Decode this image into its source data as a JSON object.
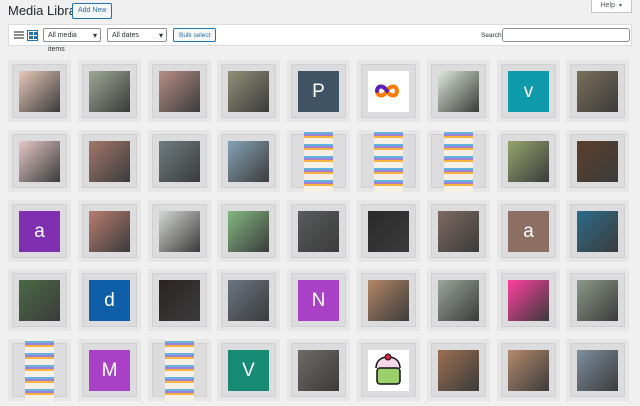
{
  "header": {
    "title": "Media Library",
    "add_new": "Add New",
    "help": "Help"
  },
  "toolbar": {
    "media_filter": "All media items",
    "date_filter": "All dates",
    "bulk_select": "Bulk select",
    "search_label": "Search",
    "search_value": ""
  },
  "media": [
    {
      "kind": "photo",
      "color": "#e8c8b8"
    },
    {
      "kind": "photo",
      "color": "#9ea895"
    },
    {
      "kind": "photo",
      "color": "#b78e85"
    },
    {
      "kind": "photo",
      "color": "#8f9076"
    },
    {
      "kind": "letter",
      "letter": "P",
      "color": "#3f5364"
    },
    {
      "kind": "icon",
      "icon": "infinity-icon",
      "color": "#ffffff"
    },
    {
      "kind": "photo",
      "color": "#dce8d8"
    },
    {
      "kind": "letter",
      "letter": "v",
      "color": "#0f9aac"
    },
    {
      "kind": "photo",
      "color": "#7a6f59"
    },
    {
      "kind": "photo",
      "color": "#e5c8c6"
    },
    {
      "kind": "photo",
      "color": "#a3776b"
    },
    {
      "kind": "photo",
      "color": "#6f7d7f"
    },
    {
      "kind": "photo",
      "color": "#86a3b6"
    },
    {
      "kind": "stickers",
      "color": "#f3f0ea"
    },
    {
      "kind": "stickers",
      "color": "#f3f0ea"
    },
    {
      "kind": "stickers",
      "color": "#f3f0ea"
    },
    {
      "kind": "photo",
      "color": "#95a46c"
    },
    {
      "kind": "photo",
      "color": "#5c3f2c"
    },
    {
      "kind": "letter",
      "letter": "a",
      "color": "#7f2fb0"
    },
    {
      "kind": "photo",
      "color": "#b87d70"
    },
    {
      "kind": "photo",
      "color": "#d5d7d3"
    },
    {
      "kind": "photo",
      "color": "#83b880"
    },
    {
      "kind": "photo",
      "color": "#5a5b5c"
    },
    {
      "kind": "photo",
      "color": "#2a2a2a"
    },
    {
      "kind": "photo",
      "color": "#7e6a61"
    },
    {
      "kind": "letter",
      "letter": "a",
      "color": "#8d6e63"
    },
    {
      "kind": "photo",
      "color": "#2c6c8a"
    },
    {
      "kind": "photo",
      "color": "#4b6a45"
    },
    {
      "kind": "letter",
      "letter": "d",
      "color": "#0f5fa8"
    },
    {
      "kind": "photo",
      "color": "#2a2424"
    },
    {
      "kind": "photo",
      "color": "#6a7480"
    },
    {
      "kind": "letter",
      "letter": "N",
      "color": "#a941c7"
    },
    {
      "kind": "photo",
      "color": "#b38666"
    },
    {
      "kind": "photo",
      "color": "#9aa59b"
    },
    {
      "kind": "photo",
      "color": "#ff3fa0"
    },
    {
      "kind": "photo",
      "color": "#8d9887"
    },
    {
      "kind": "stickers",
      "color": "#f3f0ea"
    },
    {
      "kind": "letter",
      "letter": "M",
      "color": "#a941c7"
    },
    {
      "kind": "stickers",
      "color": "#f3f0ea"
    },
    {
      "kind": "letter",
      "letter": "V",
      "color": "#168a74"
    },
    {
      "kind": "photo",
      "color": "#6f6a66"
    },
    {
      "kind": "cupcake",
      "color": "#f7f7f7"
    },
    {
      "kind": "photo",
      "color": "#9b6f51"
    },
    {
      "kind": "photo",
      "color": "#b58a6c"
    },
    {
      "kind": "photo",
      "color": "#7e8f9f"
    }
  ]
}
